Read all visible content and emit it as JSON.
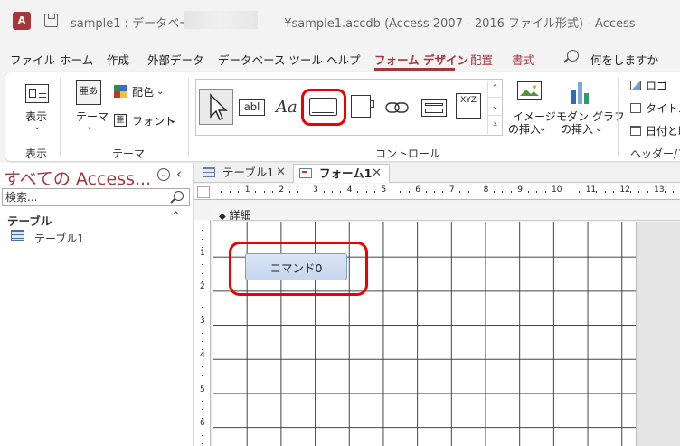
{
  "window": {
    "title": "sample1 : データベース-",
    "title_tail": "¥sample1.accdb (Access 2007 - 2016 ファイル形式)  -  Access",
    "app_icon": "access-icon"
  },
  "ribbon_tabs": [
    "ファイル",
    "ホーム",
    "作成",
    "外部データ",
    "データベース ツール",
    "ヘルプ",
    "フォーム デザイン",
    "配置",
    "書式"
  ],
  "tell_me": "何をしますか",
  "ribbon": {
    "view_label": "表示",
    "view_group": "表示",
    "theme_label": "テーマ",
    "colors_label": "配色",
    "fonts_label": "フォント",
    "theme_group": "テーマ",
    "controls_group": "コントロール",
    "textbox_glyph": "abl",
    "label_glyph": "Aa",
    "combo_glyph": "XYZ",
    "image_insert": [
      "イメージ",
      "の挿入"
    ],
    "modern_chart": [
      "モダン グラフ",
      "の挿入"
    ],
    "logo_label": "ロゴ",
    "title_label": "タイトル",
    "datetime_label": "日付と時",
    "header_group": "ヘッダー/フッ"
  },
  "nav": {
    "title": "すべての Access...",
    "search_placeholder": "検索...",
    "section": "テーブル",
    "items": [
      "テーブル1"
    ]
  },
  "doc_tabs": [
    "テーブル1",
    "フォーム1"
  ],
  "ruler_marks": [
    "1",
    "2",
    "3",
    "4",
    "5",
    "6",
    "7",
    "8",
    "9",
    "10",
    "11",
    "12",
    "13"
  ],
  "vruler_marks": [
    "1",
    "2",
    "3",
    "4",
    "5",
    "6"
  ],
  "section_label": "詳細",
  "command_button": "コマンド0",
  "colors": {
    "accent": "#a4373a",
    "highlight": "#e00000"
  }
}
